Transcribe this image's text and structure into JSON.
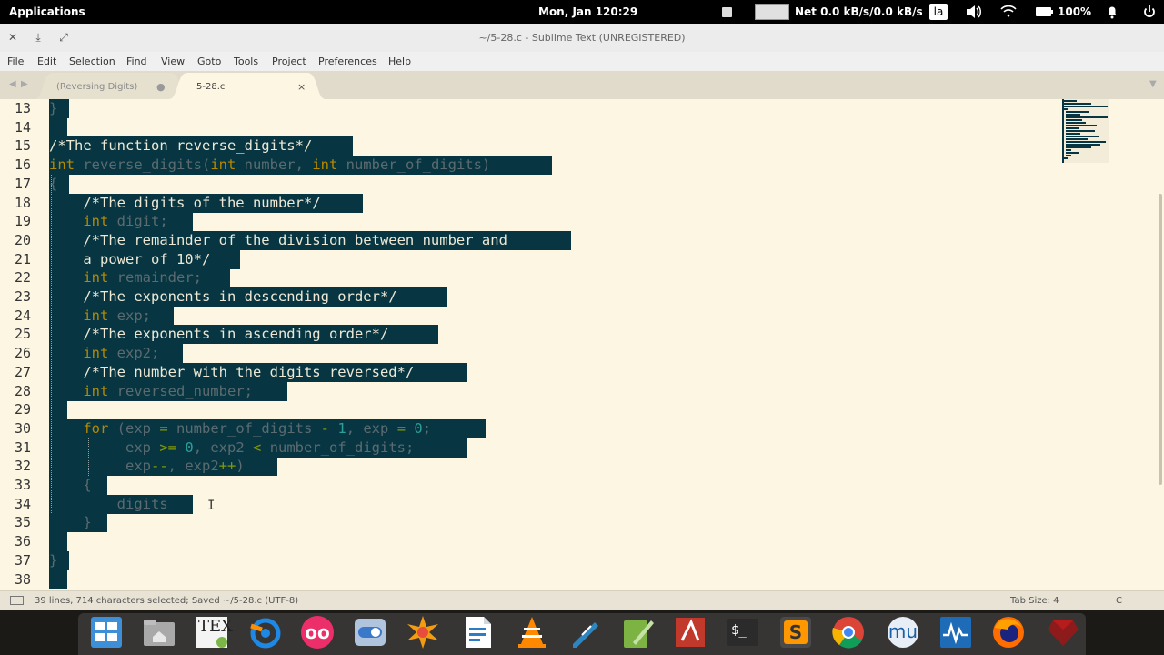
{
  "topbar": {
    "applications": "Applications",
    "date": "Mon, Jan 1",
    "time": "20:29",
    "net": "Net 0.0 kB/s/0.0 kB/s",
    "keyboard": "la",
    "battery": "100%",
    "icons": [
      "stop-icon",
      "graph-icon",
      "volume-icon",
      "wifi-icon",
      "battery-icon",
      "bell-icon",
      "power-icon"
    ]
  },
  "window": {
    "title": "~/5-28.c - Sublime Text (UNREGISTERED)",
    "buttons": [
      "close-icon",
      "minimize-icon",
      "maximize-icon"
    ]
  },
  "menu": [
    "File",
    "Edit",
    "Selection",
    "Find",
    "View",
    "Goto",
    "Tools",
    "Project",
    "Preferences",
    "Help"
  ],
  "tabs": [
    {
      "label": "(Reversing Digits)",
      "active": false,
      "close": "●"
    },
    {
      "label": "5-28.c",
      "active": true,
      "close": "×"
    }
  ],
  "editor": {
    "line_numbers": [
      "13",
      "14",
      "15",
      "16",
      "17",
      "18",
      "19",
      "20",
      "21",
      "22",
      "23",
      "24",
      "25",
      "26",
      "27",
      "28",
      "29",
      "30",
      "31",
      "32",
      "33",
      "34",
      "35",
      "36",
      "37",
      "38"
    ],
    "lines": [
      [
        {
          "t": "}",
          "c": "id"
        }
      ],
      [],
      [
        {
          "t": "/*The function reverse_digits*/",
          "c": "com"
        }
      ],
      [
        {
          "t": "int",
          "c": "kw"
        },
        {
          "t": " reverse_digits(",
          "c": "id"
        },
        {
          "t": "int",
          "c": "kw"
        },
        {
          "t": " number, ",
          "c": "id"
        },
        {
          "t": "int",
          "c": "kw"
        },
        {
          "t": " number_of_digits)",
          "c": "id"
        }
      ],
      [
        {
          "t": "{",
          "c": "id"
        }
      ],
      [
        {
          "t": "    ",
          "c": "id"
        },
        {
          "t": "/*The digits of the number*/",
          "c": "com"
        }
      ],
      [
        {
          "t": "    ",
          "c": "id"
        },
        {
          "t": "int",
          "c": "kw"
        },
        {
          "t": " digit;",
          "c": "id"
        }
      ],
      [
        {
          "t": "    ",
          "c": "id"
        },
        {
          "t": "/*The remainder of the division between number and",
          "c": "com"
        }
      ],
      [
        {
          "t": "    ",
          "c": "id"
        },
        {
          "t": "a power of 10*/",
          "c": "com"
        }
      ],
      [
        {
          "t": "    ",
          "c": "id"
        },
        {
          "t": "int",
          "c": "kw"
        },
        {
          "t": " remainder;",
          "c": "id"
        }
      ],
      [
        {
          "t": "    ",
          "c": "id"
        },
        {
          "t": "/*The exponents in descending order*/",
          "c": "com"
        }
      ],
      [
        {
          "t": "    ",
          "c": "id"
        },
        {
          "t": "int",
          "c": "kw"
        },
        {
          "t": " exp;",
          "c": "id"
        }
      ],
      [
        {
          "t": "    ",
          "c": "id"
        },
        {
          "t": "/*The exponents in ascending order*/",
          "c": "com"
        }
      ],
      [
        {
          "t": "    ",
          "c": "id"
        },
        {
          "t": "int",
          "c": "kw"
        },
        {
          "t": " exp2;",
          "c": "id"
        }
      ],
      [
        {
          "t": "    ",
          "c": "id"
        },
        {
          "t": "/*The number with the digits reversed*/",
          "c": "com"
        }
      ],
      [
        {
          "t": "    ",
          "c": "id"
        },
        {
          "t": "int",
          "c": "kw"
        },
        {
          "t": " reversed_number;",
          "c": "id"
        }
      ],
      [],
      [
        {
          "t": "    ",
          "c": "id"
        },
        {
          "t": "for",
          "c": "kw"
        },
        {
          "t": " (exp ",
          "c": "id"
        },
        {
          "t": "=",
          "c": "op"
        },
        {
          "t": " number_of_digits ",
          "c": "id"
        },
        {
          "t": "-",
          "c": "op"
        },
        {
          "t": " ",
          "c": "id"
        },
        {
          "t": "1",
          "c": "num"
        },
        {
          "t": ", exp ",
          "c": "id"
        },
        {
          "t": "=",
          "c": "op"
        },
        {
          "t": " ",
          "c": "id"
        },
        {
          "t": "0",
          "c": "num"
        },
        {
          "t": ";",
          "c": "id"
        }
      ],
      [
        {
          "t": "         exp ",
          "c": "id"
        },
        {
          "t": ">=",
          "c": "op"
        },
        {
          "t": " ",
          "c": "id"
        },
        {
          "t": "0",
          "c": "num"
        },
        {
          "t": ", exp2 ",
          "c": "id"
        },
        {
          "t": "<",
          "c": "op"
        },
        {
          "t": " number_of_digits;",
          "c": "id"
        }
      ],
      [
        {
          "t": "         exp",
          "c": "id"
        },
        {
          "t": "--",
          "c": "op"
        },
        {
          "t": ", exp2",
          "c": "id"
        },
        {
          "t": "++",
          "c": "op"
        },
        {
          "t": ")",
          "c": "id"
        }
      ],
      [
        {
          "t": "    {",
          "c": "id"
        }
      ],
      [
        {
          "t": "        digits",
          "c": "id"
        }
      ],
      [
        {
          "t": "    }",
          "c": "id"
        }
      ],
      [],
      [
        {
          "t": "}",
          "c": "id"
        }
      ],
      []
    ]
  },
  "status": {
    "left": "39 lines, 714 characters selected; Saved ~/5-28.c (UTF-8)",
    "tab_size": "Tab Size: 4",
    "syntax": "C"
  },
  "dock": {
    "icons": [
      "window-switcher-icon",
      "home-folder-icon",
      "texmaker-icon",
      "blender-icon",
      "flickr-icon",
      "settings-toggle-icon",
      "inkscape-icon",
      "writer-icon",
      "vlc-icon",
      "pen-icon",
      "notepad-icon",
      "pdf-reader-icon",
      "terminal-icon",
      "sublime-text-icon",
      "chrome-icon",
      "musescore-icon",
      "system-monitor-icon",
      "firefox-icon",
      "ruby-icon"
    ],
    "texmaker_label": "TEX",
    "terminal_label": "$_",
    "sublime_label": "S",
    "musescore_label": "mu",
    "flickr_label": "oo"
  }
}
